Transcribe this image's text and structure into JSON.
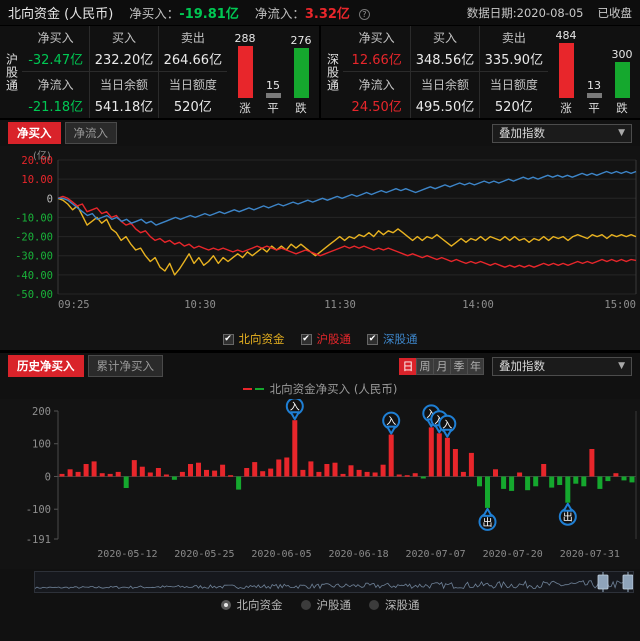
{
  "header": {
    "title": "北向资金 (人民币)",
    "net_buy_label": "净买入：",
    "net_buy_value": "-19.81亿",
    "net_inflow_label": "净流入：",
    "net_inflow_value": "3.32亿",
    "help_icon": "question-circle-icon",
    "data_date": "数据日期:2020-08-05",
    "market_status": "已收盘"
  },
  "panels": [
    {
      "name": "沪股通",
      "cells": [
        {
          "key": "净买入",
          "value": "-32.47亿",
          "tone": "green"
        },
        {
          "key": "买入",
          "value": "232.20亿",
          "tone": "neutral"
        },
        {
          "key": "卖出",
          "value": "264.66亿",
          "tone": "neutral"
        },
        {
          "key": "净流入",
          "value": "-21.18亿",
          "tone": "green"
        },
        {
          "key": "当日余额",
          "value": "541.18亿",
          "tone": "neutral"
        },
        {
          "key": "当日额度",
          "value": "520亿",
          "tone": "neutral"
        }
      ],
      "updown": {
        "up": {
          "count": "288",
          "label": "涨"
        },
        "flat": {
          "count": "15",
          "label": "平"
        },
        "down": {
          "count": "276",
          "label": "跌"
        }
      }
    },
    {
      "name": "深股通",
      "cells": [
        {
          "key": "净买入",
          "value": "12.66亿",
          "tone": "red"
        },
        {
          "key": "买入",
          "value": "348.56亿",
          "tone": "neutral"
        },
        {
          "key": "卖出",
          "value": "335.90亿",
          "tone": "neutral"
        },
        {
          "key": "净流入",
          "value": "24.50亿",
          "tone": "red"
        },
        {
          "key": "当日余额",
          "value": "495.50亿",
          "tone": "neutral"
        },
        {
          "key": "当日额度",
          "value": "520亿",
          "tone": "neutral"
        }
      ],
      "updown": {
        "up": {
          "count": "484",
          "label": "涨"
        },
        "flat": {
          "count": "13",
          "label": "平"
        },
        "down": {
          "count": "300",
          "label": "跌"
        }
      }
    }
  ],
  "chart1": {
    "tabs": [
      {
        "label": "净买入",
        "active": true
      },
      {
        "label": "净流入",
        "active": false
      }
    ],
    "overlay_select": "叠加指数",
    "chevron_icon": "chevron-down-icon",
    "legend": [
      {
        "label": "北向资金",
        "color": "#e8b220",
        "checked": true
      },
      {
        "label": "沪股通",
        "color": "#e8262b",
        "checked": true
      },
      {
        "label": "深股通",
        "color": "#3d85c8",
        "checked": true
      }
    ]
  },
  "chart2": {
    "tabs": [
      {
        "label": "历史净买入",
        "active": true
      },
      {
        "label": "累计净买入",
        "active": false
      }
    ],
    "periods": [
      {
        "label": "日",
        "active": true
      },
      {
        "label": "周",
        "active": false
      },
      {
        "label": "月",
        "active": false
      },
      {
        "label": "季",
        "active": false
      },
      {
        "label": "年",
        "active": false
      }
    ],
    "overlay_select": "叠加指数",
    "sublegend": "北向资金净买入 (人民币)",
    "legend": [
      {
        "label": "北向资金",
        "selected": true
      },
      {
        "label": "沪股通",
        "selected": false
      },
      {
        "label": "深股通",
        "selected": false
      }
    ]
  },
  "chart_data": [
    {
      "type": "line",
      "title": "",
      "unit": "(亿)",
      "xlabel": "",
      "ylabel": "",
      "ylim": [
        -50,
        20
      ],
      "yticks": [
        "20.00",
        "10.00",
        "0",
        "-10.00",
        "-20.00",
        "-30.00",
        "-40.00",
        "-50.00"
      ],
      "xticks": [
        "09:25",
        "10:30",
        "11:30",
        "14:00",
        "15:00"
      ],
      "grid": true,
      "legend_position": "bottom",
      "series": [
        {
          "name": "北向资金",
          "color": "#e8b220",
          "values": [
            0,
            -1,
            -3,
            -6,
            -4,
            -9,
            -14,
            -12,
            -10,
            -13,
            -11,
            -16,
            -18,
            -22,
            -20,
            -24,
            -27,
            -26,
            -30,
            -33,
            -31,
            -36,
            -38,
            -34,
            -40,
            -37,
            -33,
            -29,
            -34,
            -31,
            -35,
            -33,
            -30,
            -34,
            -31,
            -33,
            -31,
            -29,
            -31,
            -28,
            -30,
            -28,
            -26,
            -28,
            -25,
            -27,
            -25,
            -27,
            -24,
            -26,
            -24,
            -26,
            -28,
            -30,
            -28,
            -26,
            -24,
            -22,
            -20,
            -22,
            -20,
            -21,
            -19,
            -20,
            -18,
            -20,
            -17,
            -19,
            -17,
            -18,
            -16,
            -18,
            -20,
            -22,
            -20,
            -22,
            -20,
            -21,
            -19,
            -21,
            -23,
            -25,
            -23,
            -21,
            -23,
            -21,
            -22,
            -20,
            -22,
            -20,
            -21,
            -22,
            -20,
            -22,
            -20,
            -22,
            -21,
            -23,
            -21,
            -22,
            -20,
            -22,
            -20,
            -21,
            -20,
            -22,
            -20,
            -19,
            -20,
            -21,
            -19,
            -20,
            -19,
            -21,
            -19,
            -20,
            -19,
            -20,
            -19,
            -20
          ]
        },
        {
          "name": "沪股通",
          "color": "#e8262b",
          "values": [
            0,
            1,
            0,
            -2,
            -4,
            -3,
            -7,
            -6,
            -5,
            -8,
            -7,
            -10,
            -9,
            -12,
            -14,
            -13,
            -16,
            -18,
            -17,
            -20,
            -22,
            -21,
            -23,
            -22,
            -24,
            -23,
            -25,
            -24,
            -26,
            -25,
            -26,
            -27,
            -26,
            -27,
            -26,
            -27,
            -28,
            -27,
            -28,
            -27,
            -26,
            -25,
            -26,
            -25,
            -26,
            -27,
            -26,
            -27,
            -28,
            -29,
            -28,
            -27,
            -28,
            -29,
            -30,
            -29,
            -28,
            -27,
            -26,
            -25,
            -26,
            -25,
            -26,
            -25,
            -26,
            -27,
            -26,
            -27,
            -26,
            -27,
            -28,
            -29,
            -30,
            -29,
            -30,
            -31,
            -30,
            -31,
            -32,
            -31,
            -32,
            -33,
            -32,
            -33,
            -34,
            -33,
            -34,
            -33,
            -34,
            -35,
            -34,
            -35,
            -36,
            -35,
            -36,
            -35,
            -36,
            -35,
            -36,
            -35,
            -34,
            -35,
            -34,
            -35,
            -34,
            -35,
            -34,
            -33,
            -34,
            -33,
            -34,
            -33,
            -32,
            -33,
            -32,
            -33,
            -32,
            -33,
            -32,
            -32.5
          ]
        },
        {
          "name": "深股通",
          "color": "#3d85c8",
          "values": [
            0,
            0,
            -1,
            -3,
            -5,
            -7,
            -9,
            -8,
            -11,
            -10,
            -9,
            -11,
            -10,
            -12,
            -11,
            -13,
            -12,
            -11,
            -13,
            -12,
            -14,
            -13,
            -12,
            -11,
            -10,
            -11,
            -10,
            -9,
            -10,
            -9,
            -8,
            -9,
            -8,
            -7,
            -8,
            -7,
            -6,
            -7,
            -6,
            -5,
            -6,
            -5,
            -4,
            -5,
            -4,
            -3,
            -4,
            -3,
            -2,
            -3,
            -2,
            -1,
            -2,
            -1,
            0,
            -1,
            0,
            1,
            0,
            1,
            2,
            1,
            2,
            3,
            2,
            3,
            4,
            3,
            4,
            5,
            4,
            5,
            4,
            3,
            4,
            5,
            6,
            5,
            6,
            7,
            6,
            7,
            8,
            7,
            8,
            7,
            8,
            9,
            8,
            9,
            8,
            9,
            10,
            9,
            10,
            11,
            10,
            11,
            10,
            11,
            12,
            11,
            12,
            11,
            12,
            11,
            12,
            13,
            12,
            13,
            12,
            13,
            14,
            13,
            14,
            13,
            14,
            13,
            14
          ]
        }
      ]
    },
    {
      "type": "bar",
      "title": "北向资金净买入 (人民币)",
      "xlabel": "",
      "ylabel": "",
      "ylim": [
        -191,
        200
      ],
      "yticks": [
        "200",
        "100",
        "0",
        "-100",
        "-191"
      ],
      "xticks": [
        "2020-05-12",
        "2020-05-25",
        "2020-06-05",
        "2020-06-18",
        "2020-07-07",
        "2020-07-20",
        "2020-07-31"
      ],
      "positive_color": "#e8262b",
      "negative_color": "#15a82e",
      "values": [
        8,
        22,
        14,
        38,
        46,
        10,
        8,
        14,
        -35,
        50,
        30,
        12,
        26,
        6,
        -10,
        14,
        38,
        42,
        20,
        18,
        36,
        4,
        -40,
        26,
        44,
        16,
        24,
        52,
        58,
        172,
        20,
        46,
        14,
        38,
        42,
        8,
        34,
        20,
        14,
        12,
        36,
        128,
        6,
        4,
        10,
        -6,
        150,
        132,
        118,
        84,
        14,
        72,
        -30,
        -96,
        22,
        -38,
        -44,
        12,
        -42,
        -30,
        38,
        -34,
        -26,
        -80,
        -22,
        -30,
        84,
        -38,
        -14,
        10,
        -12,
        -18
      ],
      "markers": [
        {
          "index": 29,
          "type": "in",
          "label": "入"
        },
        {
          "index": 41,
          "type": "in",
          "label": "入"
        },
        {
          "index": 46,
          "type": "in",
          "label": "入"
        },
        {
          "index": 47,
          "type": "in",
          "label": "入"
        },
        {
          "index": 48,
          "type": "in",
          "label": "入"
        },
        {
          "index": 53,
          "type": "out",
          "label": "出"
        },
        {
          "index": 63,
          "type": "out",
          "label": "出"
        }
      ]
    }
  ]
}
